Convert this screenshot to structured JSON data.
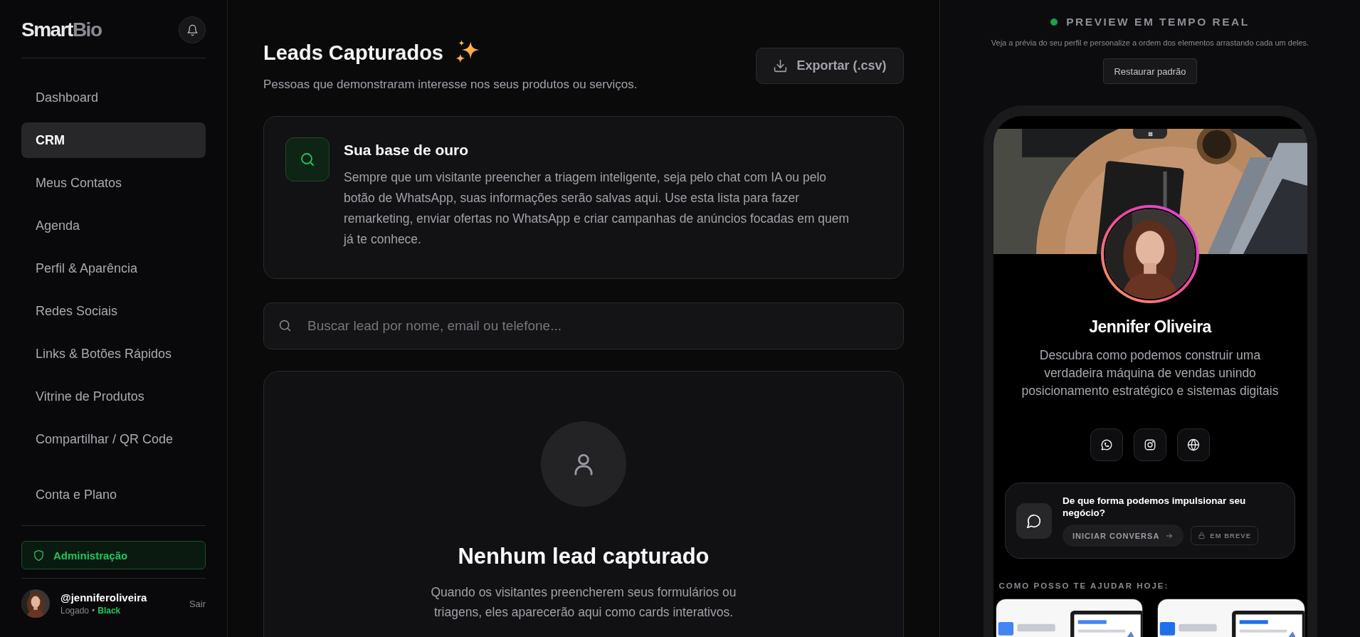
{
  "brand": {
    "name_primary": "Smart",
    "name_secondary": "Bio"
  },
  "nav": [
    {
      "label": "Dashboard",
      "selected": false
    },
    {
      "label": "CRM",
      "selected": true
    },
    {
      "label": "Meus Contatos",
      "selected": false
    },
    {
      "label": "Agenda",
      "selected": false
    },
    {
      "label": "Perfil & Aparência",
      "selected": false
    },
    {
      "label": "Redes Sociais",
      "selected": false
    },
    {
      "label": "Links & Botões Rápidos",
      "selected": false
    },
    {
      "label": "Vitrine de Produtos",
      "selected": false
    },
    {
      "label": "Compartilhar / QR Code",
      "selected": false
    }
  ],
  "account_item": {
    "label": "Conta e Plano",
    "selected": false
  },
  "admin_button": {
    "label": "Administração"
  },
  "user": {
    "handle": "@jenniferoliveira",
    "status": "Logado",
    "separator": "•",
    "plan": "Black",
    "logout": "Sair"
  },
  "page": {
    "title": "Leads Capturados",
    "subtitle": "Pessoas que demonstraram interesse nos seus produtos ou serviços.",
    "export_button": "Exportar (.csv)"
  },
  "info_card": {
    "title": "Sua base de ouro",
    "text": "Sempre que um visitante preencher a triagem inteligente, seja pelo chat com IA ou pelo botão de WhatsApp, suas informações serão salvas aqui. Use esta lista para fazer remarketing, enviar ofertas no WhatsApp e criar campanhas de anúncios focadas em quem já te conhece."
  },
  "search": {
    "placeholder": "Buscar lead por nome, email ou telefone..."
  },
  "empty_state": {
    "title": "Nenhum lead capturado",
    "text": "Quando os visitantes preencherem seus formulários ou triagens, eles aparecerão aqui como cards interativos."
  },
  "preview": {
    "title": "PREVIEW EM TEMPO REAL",
    "subtitle": "Veja a prévia do seu perfil e personalize a ordem dos elementos arrastando cada um deles.",
    "restore_button": "Restaurar padrão",
    "profile": {
      "name": "Jennifer Oliveira",
      "bio": "Descubra como podemos construir uma verdadeira máquina de vendas unindo posicionamento estratégico e sistemas digitais",
      "socials": [
        {
          "kind": "whatsapp"
        },
        {
          "kind": "instagram"
        },
        {
          "kind": "web"
        }
      ]
    },
    "chat_card": {
      "title": "De que forma podemos impulsionar seu negócio?",
      "start_button": "INICIAR CONVERSA",
      "soon_badge": "EM BREVE"
    },
    "services_heading": "COMO POSSO TE AJUDAR HOJE:"
  }
}
